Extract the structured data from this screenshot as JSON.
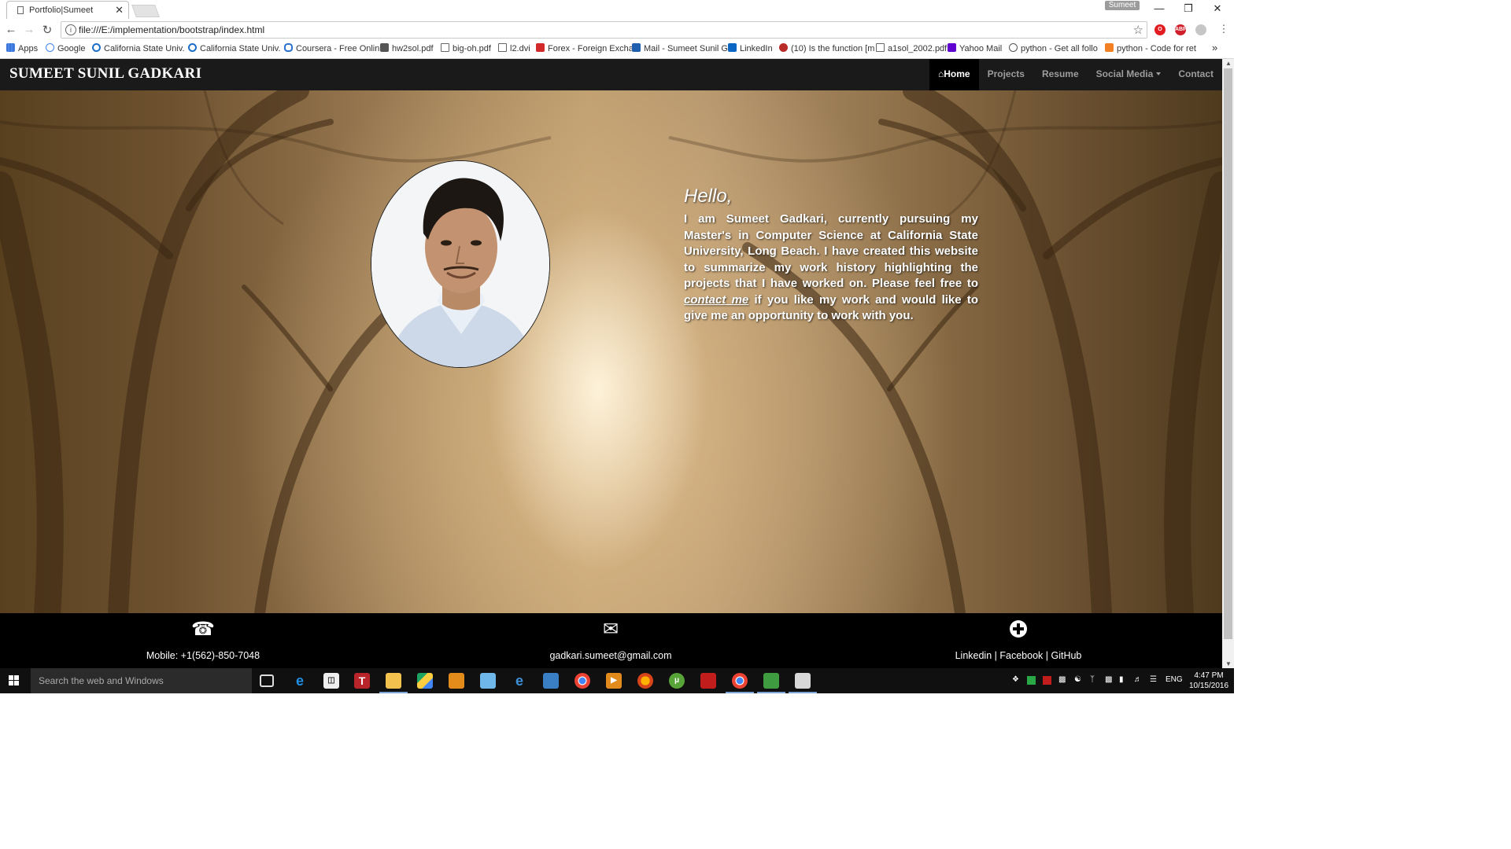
{
  "browser": {
    "tab_title": "Portfolio|Sumeet",
    "tab_close": "✕",
    "profile_name": "Sumeet",
    "url": "file:///E:/implementation/bootstrap/index.html",
    "bookmarks": [
      {
        "label": "Apps",
        "icon": "apps-icon",
        "color": "#4a7bd1"
      },
      {
        "label": "Google",
        "icon": "google-icon",
        "color": "#ffffff"
      },
      {
        "label": "California State Univ.",
        "icon": "csulb-icon",
        "color": "#1b6fc8"
      },
      {
        "label": "California State Univ.",
        "icon": "csulb-icon",
        "color": "#1b6fc8"
      },
      {
        "label": "Coursera - Free Onlin",
        "icon": "coursera-icon",
        "color": "#2a73cc"
      },
      {
        "label": "hw2sol.pdf",
        "icon": "tex-icon",
        "color": "#555555"
      },
      {
        "label": "big-oh.pdf",
        "icon": "document-icon",
        "color": "#ffffff"
      },
      {
        "label": "l2.dvi",
        "icon": "document-icon",
        "color": "#ffffff"
      },
      {
        "label": "Forex - Foreign Excha",
        "icon": "forex-icon",
        "color": "#d22a2a"
      },
      {
        "label": "Mail - Sumeet Sunil G",
        "icon": "mail-icon",
        "color": "#1f5fae"
      },
      {
        "label": "LinkedIn",
        "icon": "linkedin-icon",
        "color": "#0a66c2"
      },
      {
        "label": "(10) Is the function [m",
        "icon": "quora-icon",
        "color": "#b92b27"
      },
      {
        "label": "a1sol_2002.pdf",
        "icon": "document-icon",
        "color": "#ffffff"
      },
      {
        "label": "Yahoo Mail",
        "icon": "yahoo-icon",
        "color": "#5f01d1"
      },
      {
        "label": "python - Get all follo",
        "icon": "python-icon",
        "color": "#ffffff"
      },
      {
        "label": "python - Code for ret",
        "icon": "stackoverflow-icon",
        "color": "#f48024"
      }
    ],
    "bookmarks_more": "»"
  },
  "site": {
    "brand": "SUMEET SUNIL GADKARI",
    "nav": {
      "home": "Home",
      "projects": "Projects",
      "resume": "Resume",
      "social_media": "Social Media",
      "contact": "Contact"
    },
    "hero": {
      "greeting": "Hello,",
      "bio_before_link": "I am Sumeet Gadkari, currently pursuing my Master's in Computer Science at California State University, Long Beach. I have created this website to summarize my work history highlighting the projects that I have worked on. Please feel free to ",
      "bio_link": "contact me",
      "bio_after_link": " if you like my work and would like to give me an opportunity to work with you."
    },
    "footer": {
      "phone": "Mobile: +1(562)-850-7048",
      "email": "gadkari.sumeet@gmail.com",
      "social": {
        "linkedin": "Linkedin",
        "separator": " | ",
        "facebook": "Facebook",
        "github": "GitHub"
      }
    }
  },
  "taskbar": {
    "search_placeholder": "Search the web and Windows",
    "language": "ENG",
    "time": "4:47 PM",
    "date": "10/15/2016"
  }
}
